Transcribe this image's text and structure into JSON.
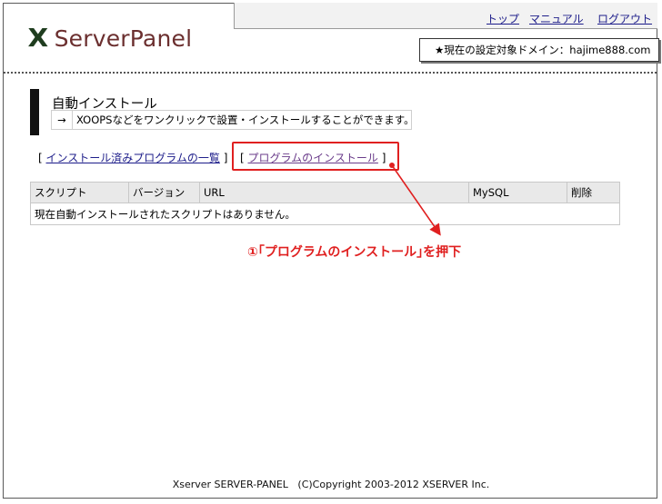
{
  "header": {
    "logo_x": "X",
    "logo_text": "ServerPanel",
    "nav": [
      "トップ",
      "マニュアル",
      "ログアウト"
    ],
    "domain_label": "★現在の設定対象ドメイン：hajime888.com"
  },
  "section": {
    "title": "自動インストール",
    "desc_arrow": "→",
    "description": "XOOPSなどをワンクリックで設置・インストールすることができます。"
  },
  "links": {
    "installed_list": "インストール済みプログラムの一覧",
    "install_program": "プログラムのインストール",
    "bracket_open": "[",
    "bracket_close": "]"
  },
  "table": {
    "headers": [
      "スクリプト",
      "バージョン",
      "URL",
      "MySQL",
      "削除"
    ],
    "empty_message": "現在自動インストールされたスクリプトはありません。"
  },
  "annotation": {
    "text": "①｢プログラムのインストール｣を押下",
    "color": "#e02020"
  },
  "footer": {
    "text": "Xserver SERVER-PANEL   (C)Copyright 2003-2012 XSERVER Inc."
  },
  "colors": {
    "logo_x": "#1f3d1f",
    "logo_text": "#6b2f2f",
    "link": "#1d1d8a",
    "highlight": "#e02020"
  }
}
